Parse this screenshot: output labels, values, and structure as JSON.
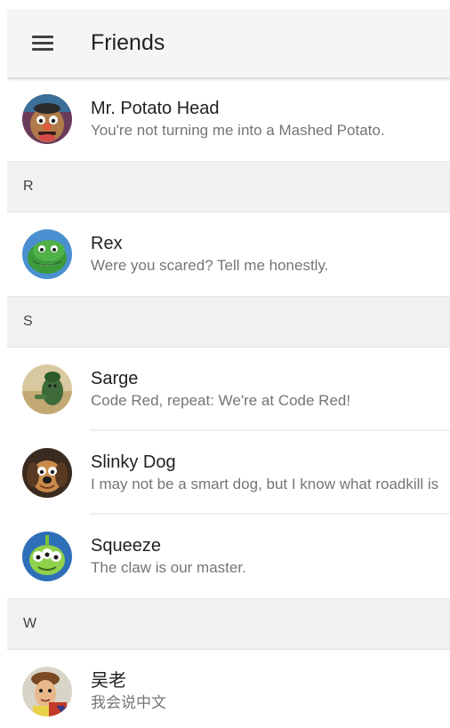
{
  "app_bar": {
    "menu_icon": "hamburger-menu-icon",
    "title": "Friends"
  },
  "groups": [
    {
      "letter": "",
      "friends": [
        {
          "name": "Mr. Potato Head",
          "message": "You're not turning me into a Mashed Potato.",
          "avatar_icon": "mr-potato-head-avatar"
        }
      ]
    },
    {
      "letter": "R",
      "friends": [
        {
          "name": "Rex",
          "message": "Were you scared? Tell me honestly.",
          "avatar_icon": "rex-avatar"
        }
      ]
    },
    {
      "letter": "S",
      "friends": [
        {
          "name": "Sarge",
          "message": "Code Red, repeat: We're at Code Red!",
          "avatar_icon": "sarge-avatar"
        },
        {
          "name": "Slinky Dog",
          "message": "I may not be a smart dog, but I know what roadkill is",
          "avatar_icon": "slinky-dog-avatar"
        },
        {
          "name": "Squeeze",
          "message": "The claw is our master.",
          "avatar_icon": "squeeze-avatar"
        }
      ]
    },
    {
      "letter": "W",
      "friends": [
        {
          "name": "吴老",
          "message": "我会说中文",
          "avatar_icon": "woody-avatar"
        }
      ]
    }
  ]
}
